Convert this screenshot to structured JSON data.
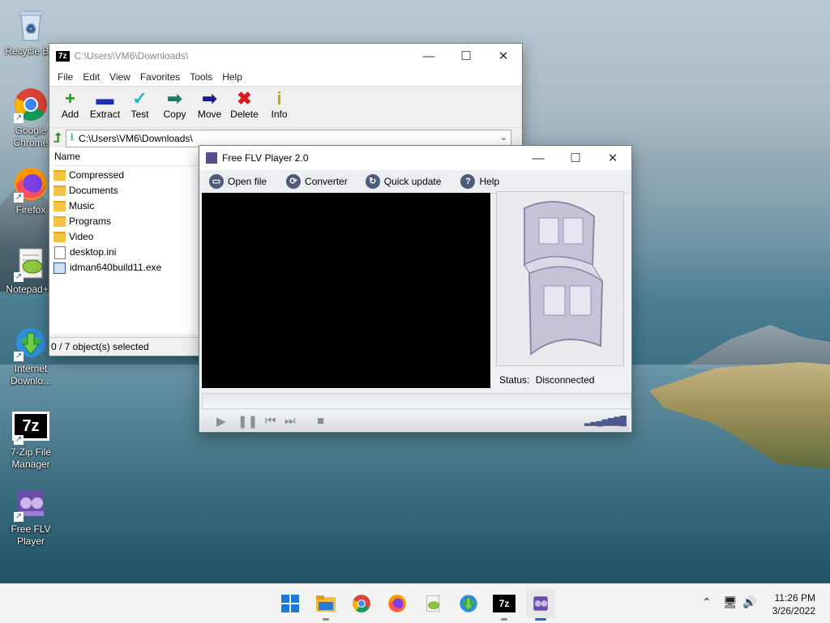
{
  "desktop": {
    "icons": [
      {
        "label": "Recycle Bin",
        "icon": "recycle-bin-icon"
      },
      {
        "label": "Google Chrome",
        "icon": "chrome-icon"
      },
      {
        "label": "Firefox",
        "icon": "firefox-icon"
      },
      {
        "label": "Notepad++",
        "icon": "notepad-plus-plus-icon"
      },
      {
        "label": "Internet Downlo...",
        "icon": "internet-download-manager-icon"
      },
      {
        "label": "7-Zip File Manager",
        "icon": "7zip-icon"
      },
      {
        "label": "Free FLV Player",
        "icon": "free-flv-player-icon"
      }
    ]
  },
  "sevenzip": {
    "title": "C:\\Users\\VM6\\Downloads\\",
    "logo": "7z",
    "menu": [
      "File",
      "Edit",
      "View",
      "Favorites",
      "Tools",
      "Help"
    ],
    "toolbar": [
      {
        "label": "Add",
        "icon": "add-icon",
        "glyph": "+",
        "color": "#1a9c1a"
      },
      {
        "label": "Extract",
        "icon": "extract-icon",
        "glyph": "▬",
        "color": "#1a2fb4"
      },
      {
        "label": "Test",
        "icon": "test-icon",
        "glyph": "✓",
        "color": "#19b8c4"
      },
      {
        "label": "Copy",
        "icon": "copy-icon",
        "glyph": "➡",
        "color": "#1f7a6a"
      },
      {
        "label": "Move",
        "icon": "move-icon",
        "glyph": "➡",
        "color": "#1a1a8c"
      },
      {
        "label": "Delete",
        "icon": "delete-icon",
        "glyph": "✖",
        "color": "#d81a1a"
      },
      {
        "label": "Info",
        "icon": "info-icon",
        "glyph": "i",
        "color": "#c8a800"
      }
    ],
    "address": "C:\\Users\\VM6\\Downloads\\",
    "column_name": "Name",
    "files": [
      {
        "name": "Compressed",
        "type": "folder"
      },
      {
        "name": "Documents",
        "type": "folder"
      },
      {
        "name": "Music",
        "type": "folder"
      },
      {
        "name": "Programs",
        "type": "folder"
      },
      {
        "name": "Video",
        "type": "folder"
      },
      {
        "name": "desktop.ini",
        "type": "file"
      },
      {
        "name": "idman640build11.exe",
        "type": "exe"
      }
    ],
    "status": "0 / 7 object(s) selected"
  },
  "flv": {
    "title": "Free FLV Player 2.0",
    "toolbar": [
      {
        "label": "Open file",
        "icon": "open-file-icon",
        "glyph": "▭"
      },
      {
        "label": "Converter",
        "icon": "converter-icon",
        "glyph": "⟳"
      },
      {
        "label": "Quick update",
        "icon": "quick-update-icon",
        "glyph": "↻"
      },
      {
        "label": "Help",
        "icon": "help-icon",
        "glyph": "?"
      }
    ],
    "status_label": "Status:",
    "status_value": "Disconnected"
  },
  "taskbar": {
    "apps": [
      {
        "name": "start",
        "icon": "windows-start-icon",
        "running": false
      },
      {
        "name": "file-explorer",
        "icon": "file-explorer-icon",
        "running": true
      },
      {
        "name": "chrome",
        "icon": "chrome-icon",
        "running": false
      },
      {
        "name": "firefox",
        "icon": "firefox-icon",
        "running": false
      },
      {
        "name": "notepad-plus-plus",
        "icon": "notepad-plus-plus-icon",
        "running": false
      },
      {
        "name": "internet-download-manager",
        "icon": "internet-download-manager-icon",
        "running": false
      },
      {
        "name": "7zip",
        "icon": "7zip-icon",
        "running": true,
        "glyph": "7z"
      },
      {
        "name": "free-flv-player",
        "icon": "free-flv-player-icon",
        "running": true
      }
    ],
    "time": "11:26 PM",
    "date": "3/26/2022"
  }
}
